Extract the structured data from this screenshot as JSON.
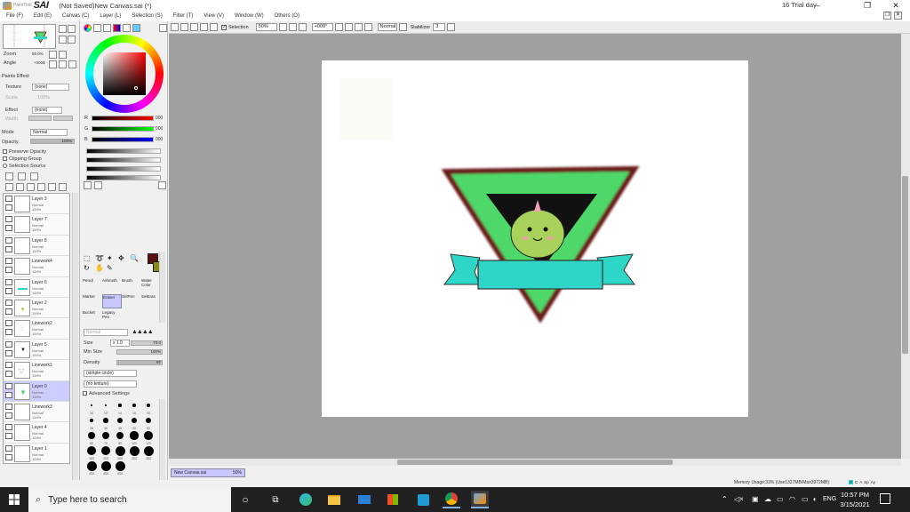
{
  "titlebar": {
    "logo_small": "PaintTool",
    "logo": "SAI",
    "doc_title": "(Not Saved)New Canvas.sai (*)",
    "trial": "16 Trial day"
  },
  "menu": [
    "File (F)",
    "Edit (E)",
    "Canvas (C)",
    "Layer (L)",
    "Selection (S)",
    "Filter (T)",
    "View (V)",
    "Window (W)",
    "Others (O)"
  ],
  "toolbar": {
    "selection_label": "Selection",
    "zoom_value": "50%",
    "angle_value": "+000°",
    "mode_value": "Normal",
    "stabilizer_label": "Stabilizer",
    "stabilizer_value": "3"
  },
  "navigator": {
    "zoom_label": "Zoom",
    "zoom_value": "50.0%",
    "angle_label": "Angle",
    "angle_value": "+000$"
  },
  "paint_effect": {
    "header": "Paints Effect",
    "texture_label": "Texture",
    "texture_value": "(none)",
    "scale_label": "Scale",
    "scale_value": "100%",
    "effect_label": "Effect",
    "effect_value": "(none)",
    "width_label": "Width"
  },
  "blend": {
    "mode_label": "Mode",
    "mode_value": "Normal",
    "opacity_label": "Opacity",
    "opacity_value": "100%",
    "preserve": "Preserve Opacity",
    "clipping": "Clipping Group",
    "selection_source": "Selection Source"
  },
  "layers": [
    {
      "name": "Layer 3",
      "mode": "Normal",
      "opacity": "100%"
    },
    {
      "name": "Layer 7",
      "mode": "Normal",
      "opacity": "100%"
    },
    {
      "name": "Layer 8",
      "mode": "Normal",
      "opacity": "100%"
    },
    {
      "name": "Linework4",
      "mode": "Normal",
      "opacity": "100%"
    },
    {
      "name": "Layer 6",
      "mode": "Normal",
      "opacity": "100%"
    },
    {
      "name": "Layer 2",
      "mode": "Normal",
      "opacity": "100%"
    },
    {
      "name": "Linework2",
      "mode": "Normal",
      "opacity": "100%"
    },
    {
      "name": "Layer 5",
      "mode": "Normal",
      "opacity": "100%"
    },
    {
      "name": "Linework1",
      "mode": "Normal",
      "opacity": "100%"
    },
    {
      "name": "Layer 0",
      "mode": "Normal",
      "opacity": "100%"
    },
    {
      "name": "Linework3",
      "mode": "Normal",
      "opacity": "100%"
    },
    {
      "name": "Layer 4",
      "mode": "Normal",
      "opacity": "100%"
    },
    {
      "name": "Layer 1",
      "mode": "Normal",
      "opacity": "100%"
    }
  ],
  "color": {
    "r_label": "R",
    "r_value": "000",
    "g_label": "G",
    "g_value": "000",
    "b_label": "B",
    "b_value": "000"
  },
  "tools": [
    "Pencil",
    "Airbrush",
    "Brush",
    "Water Color",
    "Marker",
    "Eraser",
    "SelPen",
    "SelEras",
    "Bucket",
    "Legacy Pen"
  ],
  "brush": {
    "mode_value": "Normal",
    "size_label": "Size",
    "size_mult": "x 1.0",
    "size_value": "70.0",
    "minsize_label": "Min Size",
    "minsize_value": "100%",
    "density_label": "Density",
    "density_value": "97",
    "shape_value": "(simple circle)",
    "texture_value": "(no texture)",
    "advanced": "Advanced Settings"
  },
  "brush_sizes": [
    "10",
    "12",
    "14",
    "16",
    "20",
    "25",
    "30",
    "35",
    "40",
    "50",
    "60",
    "70",
    "80",
    "100",
    "120",
    "160",
    "200",
    "250",
    "300",
    "350",
    "400",
    "450",
    "500"
  ],
  "doctab": {
    "name": "New Canvas.sai",
    "zoom": "50%"
  },
  "status": {
    "memory": "Memory Usage:33% (Use1327MB/Max3972MB)"
  },
  "taskbar": {
    "search_placeholder": "Type here to search",
    "lang": "ENG",
    "time": "10:57 PM",
    "date": "3/15/2021"
  },
  "colors": {
    "accent_layer": "#ccccff",
    "triangle": "#4fd86a",
    "banner": "#2ed6c8",
    "outline": "#6b1a1a",
    "dino": "#a8d25a"
  }
}
